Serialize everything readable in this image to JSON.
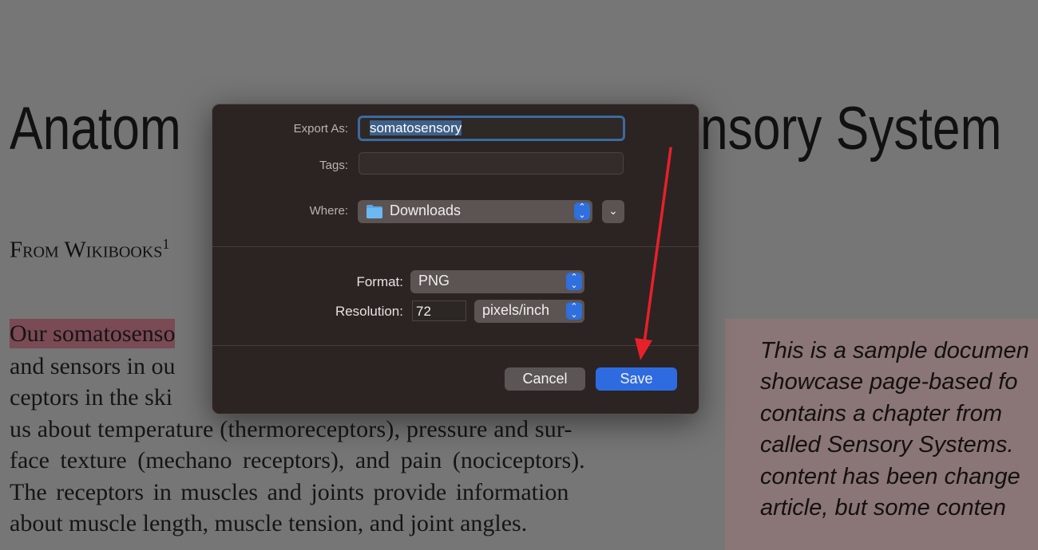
{
  "document": {
    "title_left": "Anatom",
    "title_right": "nsory System",
    "subtitle": "From Wikibooks",
    "subtitle_sup": "1",
    "body_lines": [
      "Our somatosenso",
      "and sensors in ou",
      "ceptors in the ski",
      "us about temperature (thermoreceptors), pressure and sur-",
      "face texture (mechano receptors), and pain (nociceptors).",
      "The receptors in muscles and joints provide information",
      "about muscle length, muscle tension, and joint angles."
    ],
    "sidebar_lines": [
      "This is a sample documen",
      "showcase page-based fo",
      "contains a chapter from",
      "called Sensory Systems.",
      "content has been change",
      "article, but some conten"
    ]
  },
  "dialog": {
    "export_as_label": "Export As:",
    "export_as_value": "somatosensory",
    "tags_label": "Tags:",
    "tags_value": "",
    "where_label": "Where:",
    "where_value": "Downloads",
    "format_label": "Format:",
    "format_value": "PNG",
    "resolution_label": "Resolution:",
    "resolution_value": "72",
    "resolution_unit": "pixels/inch",
    "cancel_label": "Cancel",
    "save_label": "Save"
  },
  "colors": {
    "accent": "#2e6be0",
    "annotation_arrow": "#e8202a",
    "highlight": "#7a4a55"
  },
  "icons": {
    "folder": "folder-icon",
    "stepper": "up-down-chevron-icon",
    "expand": "chevron-down-icon"
  }
}
